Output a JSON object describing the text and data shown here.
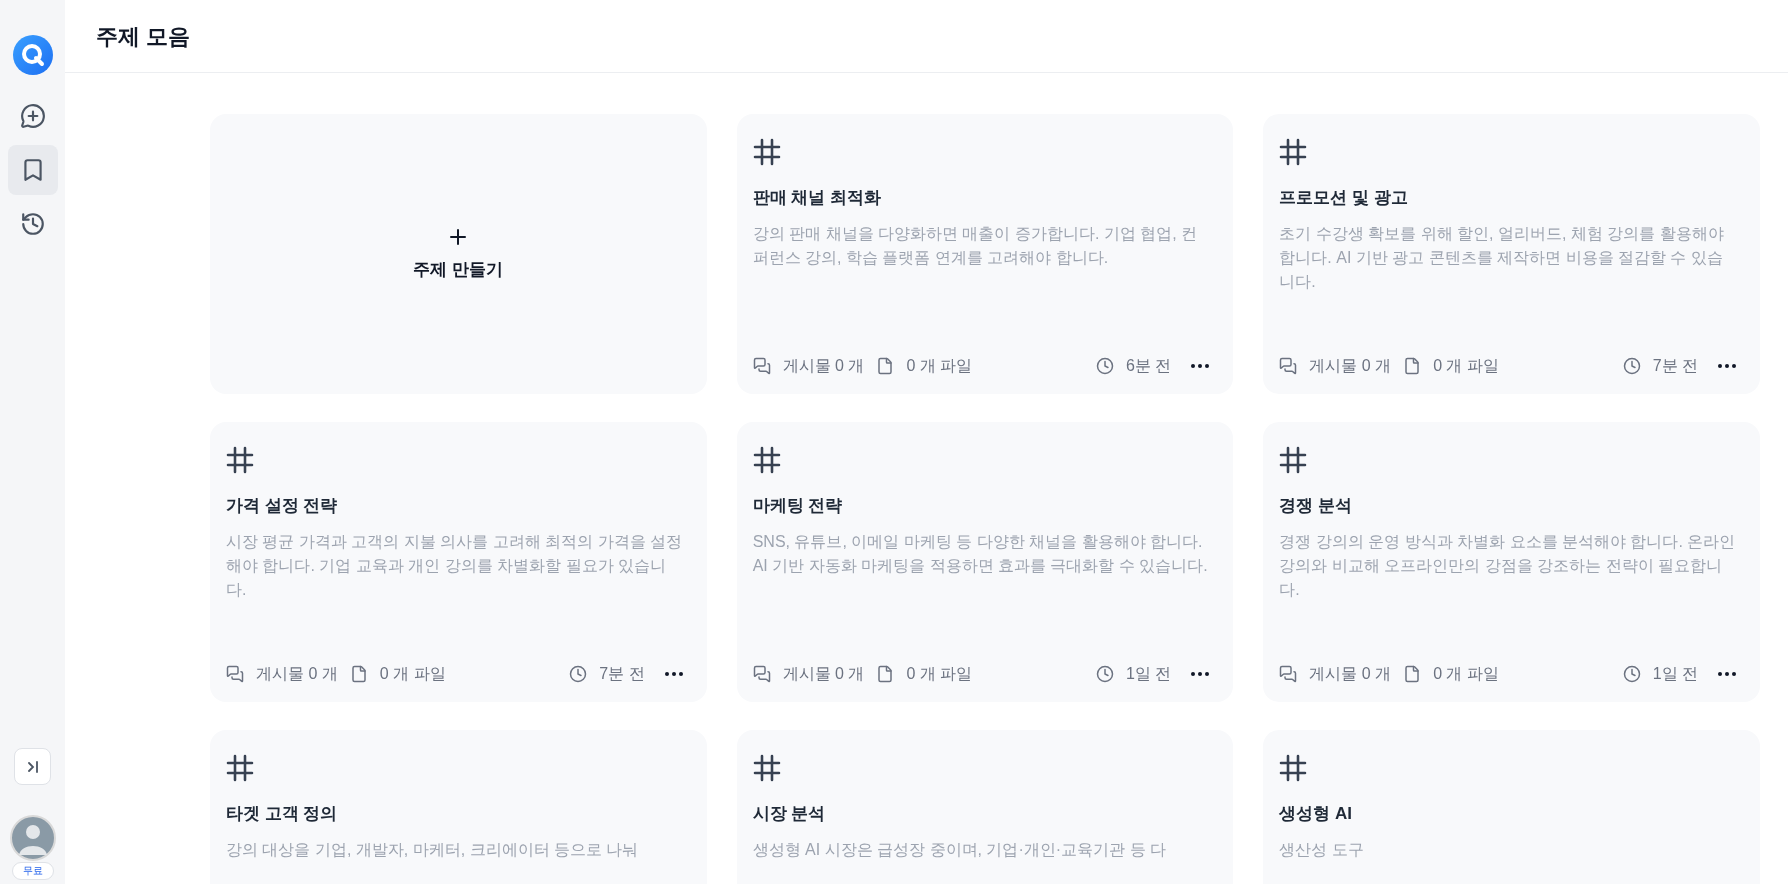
{
  "sidebar": {
    "nav": [
      {
        "kind": "new-chat",
        "selected": false
      },
      {
        "kind": "bookmarks",
        "selected": true
      },
      {
        "kind": "history",
        "selected": false
      }
    ],
    "plan_badge": "무료"
  },
  "header": {
    "title": "주제 모음"
  },
  "create_card": {
    "label": "주제 만들기"
  },
  "topics": [
    {
      "title": "판매 채널 최적화",
      "description": "강의 판매 채널을 다양화하면 매출이 증가합니다. 기업 협업, 컨퍼런스 강의, 학습 플랫폼 연계를 고려해야 합니다.",
      "posts": "게시물 0 개",
      "files": "0 개 파일",
      "time": "6분 전"
    },
    {
      "title": "프로모션 및 광고",
      "description": "초기 수강생 확보를 위해 할인, 얼리버드, 체험 강의를 활용해야 합니다. AI 기반 광고 콘텐츠를 제작하면 비용을 절감할 수 있습니다.",
      "posts": "게시물 0 개",
      "files": "0 개 파일",
      "time": "7분 전"
    },
    {
      "title": "가격 설정 전략",
      "description": "시장 평균 가격과 고객의 지불 의사를 고려해 최적의 가격을 설정해야 합니다. 기업 교육과 개인 강의를 차별화할 필요가 있습니다.",
      "posts": "게시물 0 개",
      "files": "0 개 파일",
      "time": "7분 전"
    },
    {
      "title": "마케팅 전략",
      "description": "SNS, 유튜브, 이메일 마케팅 등 다양한 채널을 활용해야 합니다. AI 기반 자동화 마케팅을 적용하면 효과를 극대화할 수 있습니다.",
      "posts": "게시물 0 개",
      "files": "0 개 파일",
      "time": "1일 전"
    },
    {
      "title": "경쟁 분석",
      "description": "경쟁 강의의 운영 방식과 차별화 요소를 분석해야 합니다. 온라인 강의와 비교해 오프라인만의 강점을 강조하는 전략이 필요합니다.",
      "posts": "게시물 0 개",
      "files": "0 개 파일",
      "time": "1일 전"
    },
    {
      "title": "타겟 고객 정의",
      "description": "강의 대상을 기업, 개발자, 마케터, 크리에이터 등으로 나눠"
    },
    {
      "title": "시장 분석",
      "description": "생성형 AI 시장은 급성장 중이며, 기업·개인·교육기관 등 다"
    },
    {
      "title": "생성형 AI",
      "description": "생산성 도구"
    }
  ]
}
